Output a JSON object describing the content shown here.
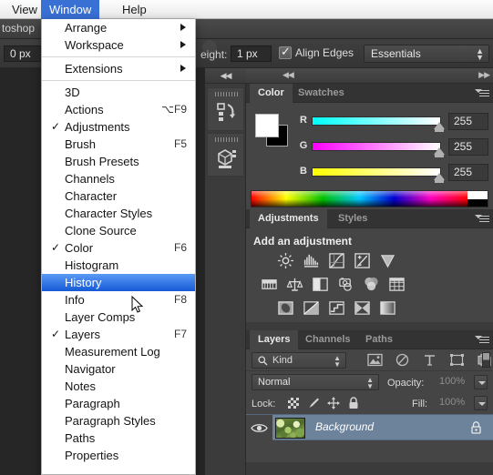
{
  "menubar": {
    "items": [
      {
        "label": "View",
        "active": false
      },
      {
        "label": "Window",
        "active": true
      },
      {
        "label": "Help",
        "active": false
      }
    ]
  },
  "appbar": {
    "breadcrumb": "toshop"
  },
  "options_bar": {
    "left_field_value": "0 px",
    "height_label": "eight:",
    "height_value": "1 px",
    "align_edges_label": "Align Edges",
    "align_edges_checked": true,
    "workspace_value": "Essentials"
  },
  "icon_dock": {
    "collapse_label": "◀◀",
    "buttons": [
      {
        "name": "history-panel-icon"
      },
      {
        "name": "3d-panel-icon"
      }
    ]
  },
  "window_menu": {
    "groups": [
      {
        "items": [
          {
            "label": "Arrange",
            "submenu": true,
            "checked": false,
            "shortcut": ""
          },
          {
            "label": "Workspace",
            "submenu": true,
            "checked": false,
            "shortcut": ""
          }
        ]
      },
      {
        "items": [
          {
            "label": "Extensions",
            "submenu": true,
            "checked": false,
            "shortcut": ""
          }
        ]
      },
      {
        "items": [
          {
            "label": "3D",
            "submenu": false,
            "checked": false,
            "shortcut": ""
          },
          {
            "label": "Actions",
            "submenu": false,
            "checked": false,
            "shortcut": "⌥F9"
          },
          {
            "label": "Adjustments",
            "submenu": false,
            "checked": true,
            "shortcut": ""
          },
          {
            "label": "Brush",
            "submenu": false,
            "checked": false,
            "shortcut": "F5"
          },
          {
            "label": "Brush Presets",
            "submenu": false,
            "checked": false,
            "shortcut": ""
          },
          {
            "label": "Channels",
            "submenu": false,
            "checked": false,
            "shortcut": ""
          },
          {
            "label": "Character",
            "submenu": false,
            "checked": false,
            "shortcut": ""
          },
          {
            "label": "Character Styles",
            "submenu": false,
            "checked": false,
            "shortcut": ""
          },
          {
            "label": "Clone Source",
            "submenu": false,
            "checked": false,
            "shortcut": ""
          },
          {
            "label": "Color",
            "submenu": false,
            "checked": true,
            "shortcut": "F6"
          },
          {
            "label": "Histogram",
            "submenu": false,
            "checked": false,
            "shortcut": ""
          },
          {
            "label": "History",
            "submenu": false,
            "checked": false,
            "shortcut": "",
            "highlighted": true
          },
          {
            "label": "Info",
            "submenu": false,
            "checked": false,
            "shortcut": "F8"
          },
          {
            "label": "Layer Comps",
            "submenu": false,
            "checked": false,
            "shortcut": ""
          },
          {
            "label": "Layers",
            "submenu": false,
            "checked": true,
            "shortcut": "F7"
          },
          {
            "label": "Measurement Log",
            "submenu": false,
            "checked": false,
            "shortcut": ""
          },
          {
            "label": "Navigator",
            "submenu": false,
            "checked": false,
            "shortcut": ""
          },
          {
            "label": "Notes",
            "submenu": false,
            "checked": false,
            "shortcut": ""
          },
          {
            "label": "Paragraph",
            "submenu": false,
            "checked": false,
            "shortcut": ""
          },
          {
            "label": "Paragraph Styles",
            "submenu": false,
            "checked": false,
            "shortcut": ""
          },
          {
            "label": "Paths",
            "submenu": false,
            "checked": false,
            "shortcut": ""
          },
          {
            "label": "Properties",
            "submenu": false,
            "checked": false,
            "shortcut": ""
          }
        ]
      }
    ]
  },
  "color_panel": {
    "tabs": [
      {
        "label": "Color",
        "selected": true
      },
      {
        "label": "Swatches",
        "selected": false
      }
    ],
    "foreground": "#ffffff",
    "background": "#000000",
    "channels": [
      {
        "label": "R",
        "value": "255"
      },
      {
        "label": "G",
        "value": "255"
      },
      {
        "label": "B",
        "value": "255"
      }
    ]
  },
  "adjustments_panel": {
    "tabs": [
      {
        "label": "Adjustments",
        "selected": true
      },
      {
        "label": "Styles",
        "selected": false
      }
    ],
    "title": "Add an adjustment",
    "icons": [
      [
        "brightness-contrast-icon",
        "levels-icon",
        "curves-icon",
        "exposure-icon",
        "vibrance-icon"
      ],
      [
        "hue-saturation-icon",
        "color-balance-icon",
        "black-white-icon",
        "photo-filter-icon",
        "channel-mixer-icon",
        "color-lookup-icon"
      ],
      [
        "invert-icon",
        "posterize-icon",
        "threshold-icon",
        "selective-color-icon",
        "gradient-map-icon"
      ]
    ]
  },
  "layers_panel": {
    "tabs": [
      {
        "label": "Layers",
        "selected": true
      },
      {
        "label": "Channels",
        "selected": false
      },
      {
        "label": "Paths",
        "selected": false
      }
    ],
    "filter_value": "Kind",
    "filter_icons": [
      "pixel-layer-filter-icon",
      "adjustment-layer-filter-icon",
      "type-layer-filter-icon",
      "shape-layer-filter-icon",
      "smart-object-filter-icon"
    ],
    "blend_mode": "Normal",
    "opacity_label": "Opacity:",
    "opacity_value": "100%",
    "lock_label": "Lock:",
    "fill_label": "Fill:",
    "fill_value": "100%",
    "lock_icons": [
      "lock-transparent-pixels-icon",
      "lock-image-pixels-icon",
      "lock-position-icon",
      "lock-all-icon"
    ],
    "rows": [
      {
        "name": "Background",
        "visible": true,
        "locked": true,
        "selected": true
      }
    ]
  }
}
